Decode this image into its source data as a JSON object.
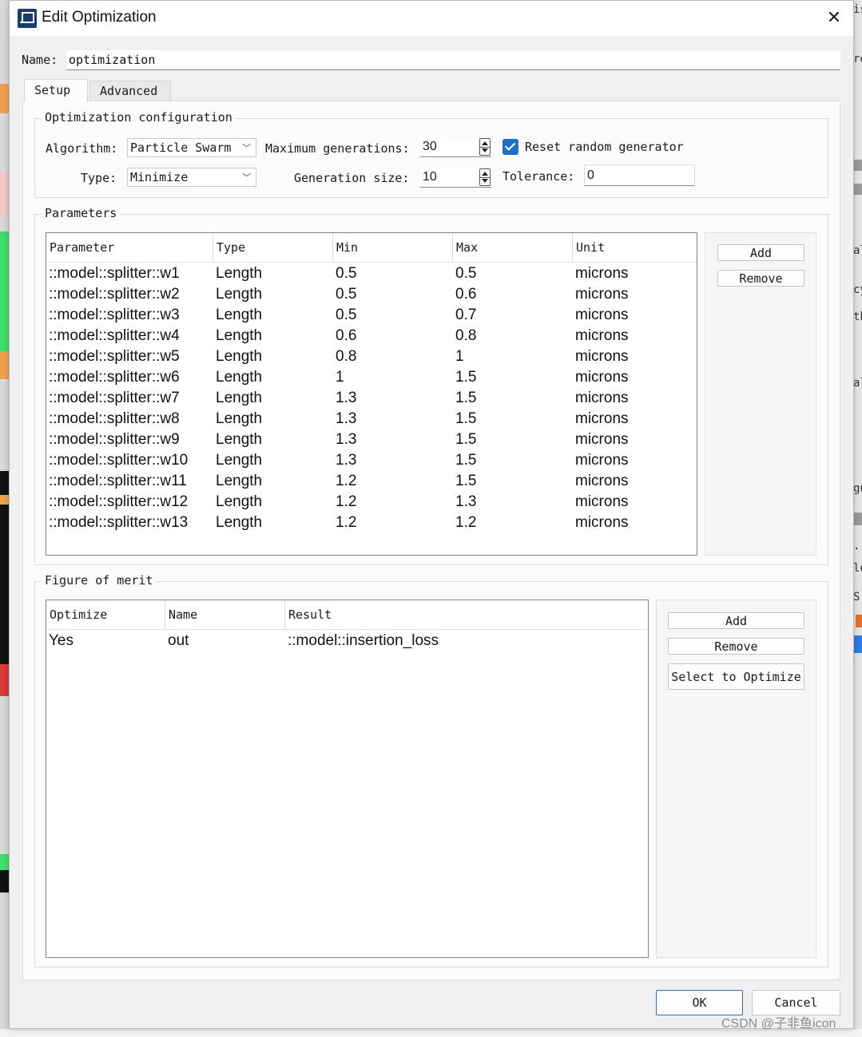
{
  "window": {
    "title": "Edit Optimization",
    "close_glyph": "✕"
  },
  "name": {
    "label": "Name:",
    "value": "optimization"
  },
  "tabs": [
    {
      "label": "Setup",
      "active": true
    },
    {
      "label": "Advanced",
      "active": false
    }
  ],
  "optimization_config": {
    "title": "Optimization configuration",
    "algorithm_label": "Algorithm:",
    "algorithm_value": "Particle Swarm",
    "type_label": "Type:",
    "type_value": "Minimize",
    "max_generations_label": "Maximum generations:",
    "max_generations_value": "30",
    "generation_size_label": "Generation size:",
    "generation_size_value": "10",
    "reset_random_label": "Reset random generator",
    "reset_random_checked": true,
    "tolerance_label": "Tolerance:",
    "tolerance_value": "0"
  },
  "parameters": {
    "title": "Parameters",
    "columns": [
      "Parameter",
      "Type",
      "Min",
      "Max",
      "Unit"
    ],
    "rows": [
      [
        "::model::splitter::w1",
        "Length",
        "0.5",
        "0.5",
        "microns"
      ],
      [
        "::model::splitter::w2",
        "Length",
        "0.5",
        "0.6",
        "microns"
      ],
      [
        "::model::splitter::w3",
        "Length",
        "0.5",
        "0.7",
        "microns"
      ],
      [
        "::model::splitter::w4",
        "Length",
        "0.6",
        "0.8",
        "microns"
      ],
      [
        "::model::splitter::w5",
        "Length",
        "0.8",
        "1",
        "microns"
      ],
      [
        "::model::splitter::w6",
        "Length",
        "1",
        "1.5",
        "microns"
      ],
      [
        "::model::splitter::w7",
        "Length",
        "1.3",
        "1.5",
        "microns"
      ],
      [
        "::model::splitter::w8",
        "Length",
        "1.3",
        "1.5",
        "microns"
      ],
      [
        "::model::splitter::w9",
        "Length",
        "1.3",
        "1.5",
        "microns"
      ],
      [
        "::model::splitter::w10",
        "Length",
        "1.3",
        "1.5",
        "microns"
      ],
      [
        "::model::splitter::w11",
        "Length",
        "1.2",
        "1.5",
        "microns"
      ],
      [
        "::model::splitter::w12",
        "Length",
        "1.2",
        "1.3",
        "microns"
      ],
      [
        "::model::splitter::w13",
        "Length",
        "1.2",
        "1.2",
        "microns"
      ]
    ],
    "add_label": "Add",
    "remove_label": "Remove"
  },
  "figure_of_merit": {
    "title": "Figure of merit",
    "columns": [
      "Optimize",
      "Name",
      "Result"
    ],
    "rows": [
      [
        "Yes",
        "out",
        "::model::insertion_loss"
      ]
    ],
    "add_label": "Add",
    "remove_label": "Remove",
    "select_label": "Select to Optimize"
  },
  "footer": {
    "ok_label": "OK",
    "cancel_label": "Cancel"
  },
  "watermark": "CSDN @子非鱼icon",
  "background_fragments": [
    "is",
    "re",
    "al",
    "cy",
    "th",
    "al",
    "gu",
    ".",
    "lo",
    "S"
  ],
  "colors": {
    "accent": "#1f6fc5",
    "ok_border": "#2a6fc1"
  }
}
